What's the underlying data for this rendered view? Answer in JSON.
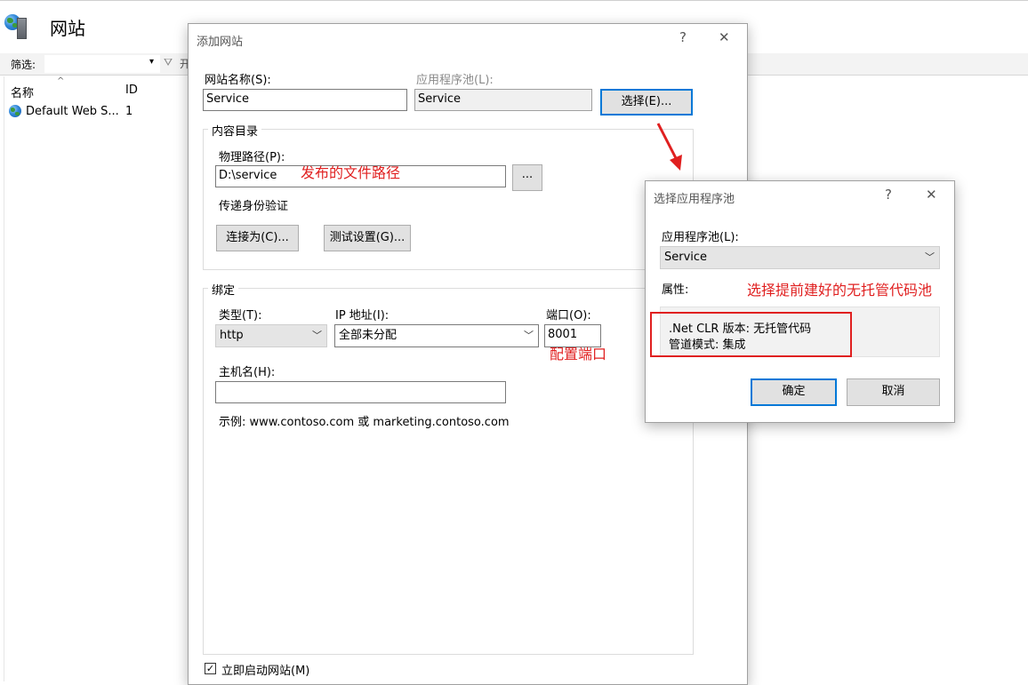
{
  "window": {
    "title": "网站",
    "filter_label": "筛选:",
    "filter_clipped_text": "开",
    "columns": {
      "name": "名称",
      "id": "ID"
    },
    "sites": [
      {
        "name": "Default Web S...",
        "id": "1"
      }
    ]
  },
  "add_site_dialog": {
    "title": "添加网站",
    "help": "?",
    "close": "✕",
    "site_name_label": "网站名称(S):",
    "site_name_value": "Service",
    "app_pool_label": "应用程序池(L):",
    "app_pool_value": "Service",
    "select_button": "选择(E)...",
    "content_group": "内容目录",
    "physical_path_label": "物理路径(P):",
    "physical_path_value": "D:\\service",
    "browse_button": "...",
    "passthrough_label": "传递身份验证",
    "connect_as_button": "连接为(C)...",
    "test_settings_button": "测试设置(G)...",
    "binding_group": "绑定",
    "type_label": "类型(T):",
    "type_value": "http",
    "ip_label": "IP 地址(I):",
    "ip_value": "全部未分配",
    "port_label": "端口(O):",
    "port_value": "8001",
    "host_label": "主机名(H):",
    "host_value": "",
    "example_text": "示例: www.contoso.com 或 marketing.contoso.com",
    "start_now_label": "立即启动网站(M)",
    "start_now_checked": true
  },
  "pool_dialog": {
    "title": "选择应用程序池",
    "help": "?",
    "close": "✕",
    "pool_label": "应用程序池(L):",
    "pool_value": "Service",
    "properties_label": "属性:",
    "clr_line": ".Net CLR 版本: 无托管代码",
    "pipeline_line": "管道模式: 集成",
    "ok_button": "确定",
    "cancel_button": "取消"
  },
  "annotations": {
    "path_note": "发布的文件路径",
    "port_note": "配置端口",
    "pool_note": "选择提前建好的无托管代码池",
    "color": "#e02020"
  }
}
